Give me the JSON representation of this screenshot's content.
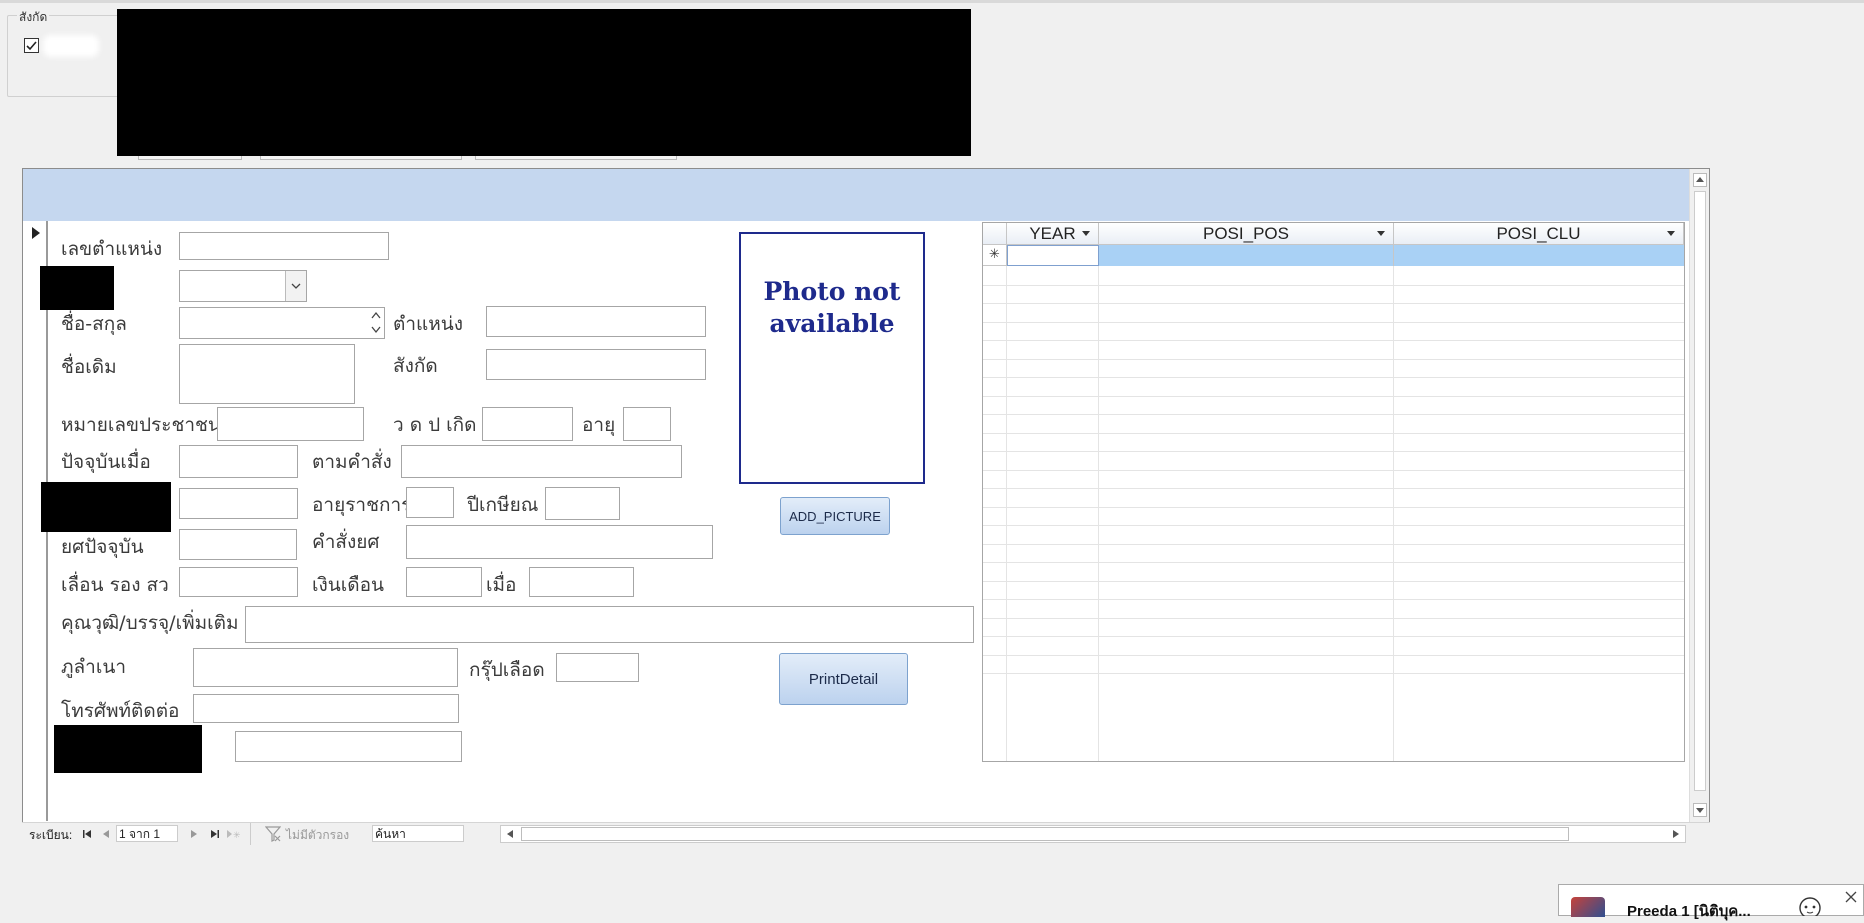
{
  "top_group": {
    "label": "สังกัด"
  },
  "form": {
    "labels": {
      "position_no": "เลขตำแหน่ง",
      "fullname": "ชื่อ-สกุล",
      "position": "ตำแหน่ง",
      "former_name": "ชื่อเดิม",
      "affiliation": "สังกัด",
      "citizen_id": "หมายเลขประชาชน",
      "birth_date": "ว ด ป เกิด",
      "age": "อายุ",
      "current_since": "ปัจจุบันเมื่อ",
      "by_order": "ตามคำสั่ง",
      "service_age": "อายุราชการ",
      "retire_year": "ปีเกษียณ",
      "current_rank": "ยศปัจจุบัน",
      "rank_order": "คำสั่งยศ",
      "promotion": "เลื่อน รอง สว",
      "salary": "เงินเดือน",
      "salary_date": "เมื่อ",
      "qualification": "คุณวุฒิ/บรรจุ/เพิ่มเติม",
      "hometown": "ภูลำเนา",
      "blood_group": "กรุ๊ปเลือด",
      "phone": "โทรศัพท์ติดต่อ"
    },
    "photo_text_1": "Photo not",
    "photo_text_2": "available",
    "add_picture_button": "ADD_PICTURE",
    "print_button": "PrintDetail"
  },
  "grid": {
    "columns": [
      "YEAR",
      "POSI_POS",
      "POSI_CLU"
    ],
    "new_row_marker": "✳"
  },
  "nav": {
    "record_label": "ระเบียน:",
    "record_position": "1 จาก 1",
    "filter_label": "ไม่มีตัวกรอง",
    "search_label": "ค้นหา"
  },
  "taskbar": {
    "preview_title": "Preeda 1 [นิติบุค..."
  },
  "colors": {
    "header_band": "#c5d7ef",
    "photo_border": "#1e2a8c",
    "grid_selected": "#a9d1f5"
  }
}
